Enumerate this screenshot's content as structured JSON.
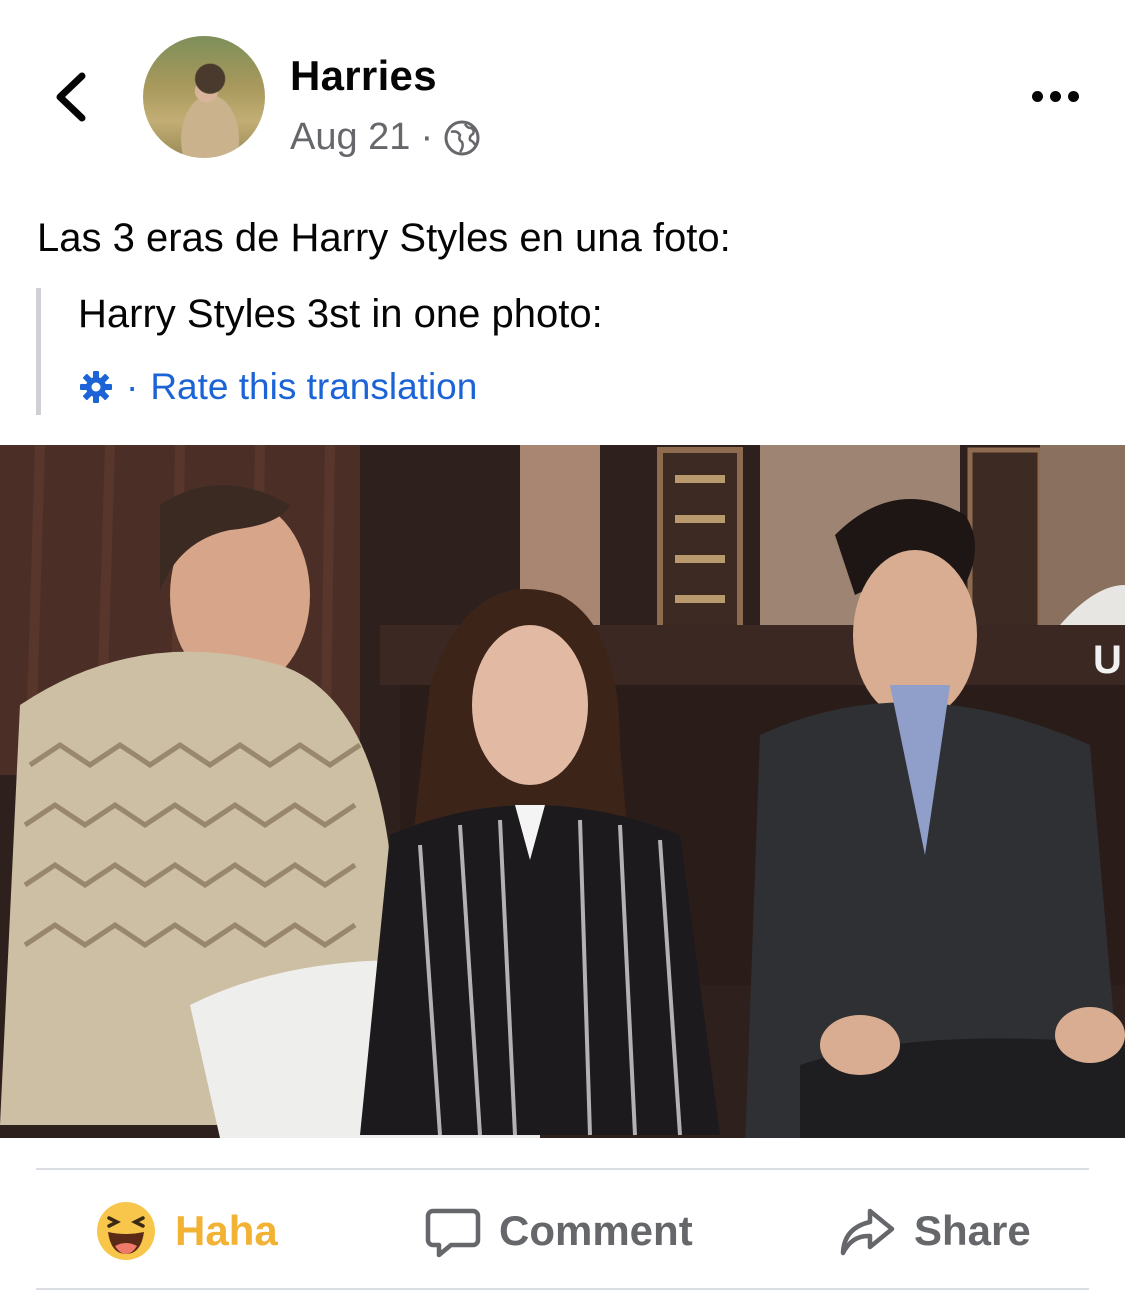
{
  "header": {
    "back_icon": "chevron-left-icon",
    "author_name": "Harries",
    "date": "Aug 21",
    "separator": "·",
    "privacy_icon": "globe-icon",
    "more_icon": "ellipsis-icon"
  },
  "post": {
    "text": "Las 3 eras de Harry Styles en una foto:",
    "translation": {
      "text": "Harry Styles 3st in one photo:",
      "settings_icon": "gear-icon",
      "separator": "·",
      "rate_label": "Rate this translation"
    },
    "photo": {
      "overlay_text": "U"
    }
  },
  "actions": {
    "reaction_label": "Haha",
    "reaction_icon": "haha-emoji-icon",
    "comment_label": "Comment",
    "comment_icon": "comment-bubble-icon",
    "share_label": "Share",
    "share_icon": "share-arrow-icon"
  },
  "colors": {
    "link_blue": "#1b63d6",
    "haha_yellow": "#f2b234",
    "secondary_text": "#65676b",
    "divider": "#dadde1"
  }
}
